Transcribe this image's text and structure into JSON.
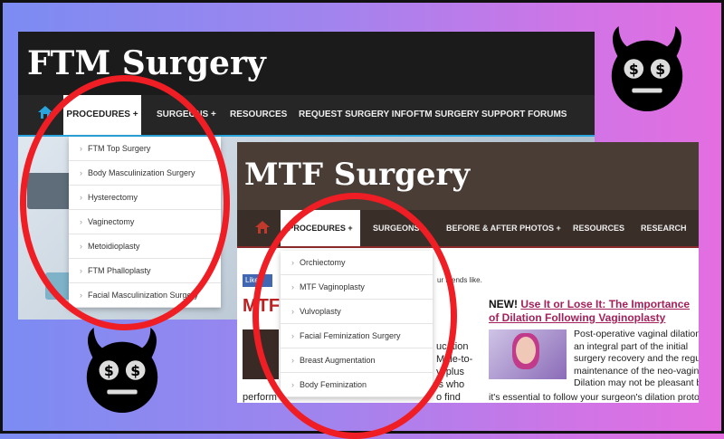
{
  "ftm": {
    "site_title": "FTM Surgery",
    "nav": [
      "PROCEDURES +",
      "SURGEONS +",
      "RESOURCES",
      "REQUEST SURGERY INFO",
      "FTM SURGERY SUPPORT FORUMS"
    ],
    "dropdown": [
      "FTM Top Surgery",
      "Body Masculinization Surgery",
      "Hysterectomy",
      "Vaginectomy",
      "Metoidioplasty",
      "FTM Phalloplasty",
      "Facial Masculinization Surgery"
    ]
  },
  "mtf": {
    "site_title": "MTF Surgery",
    "nav": [
      "PROCEDURES +",
      "SURGEONS +",
      "BEFORE & AFTER PHOTOS +",
      "RESOURCES",
      "RESEARCH"
    ],
    "dropdown": [
      "Orchiectomy",
      "MTF Vaginoplasty",
      "Vulvoplasty",
      "Facial Feminization Surgery",
      "Breast Augmentation",
      "Body Feminization"
    ],
    "fb_button": "Like",
    "fb_text": "ur friends like.",
    "page_heading": "MTF",
    "new_label": "NEW!",
    "article_title_1": "Use It or Lose It: The Importance",
    "article_title_2": "of Dilation Following Vaginoplasty",
    "body_lines": [
      "Post-operative vaginal dilation",
      "an integral part of the initial",
      "surgery recovery and the regu",
      "maintenance of the neo-vagina",
      "Dilation may not be pleasant b"
    ],
    "body_last": "it's essential to follow your surgeon's dilation proto",
    "left_snips": [
      "ucation",
      "Male-to-",
      "y, plus",
      "ls who",
      "perform",
      "o find"
    ]
  },
  "colors": {
    "ring": "#ef1d24",
    "devil": "#000000"
  },
  "icons": [
    "home-icon",
    "chevron-right-icon",
    "devil-emoji-icon"
  ]
}
